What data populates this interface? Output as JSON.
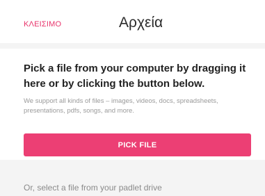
{
  "header": {
    "close_label": "ΚΛΕΙΣΙΜΟ",
    "title": "Αρχεία"
  },
  "upload": {
    "heading": "Pick a file from your computer by dragging it here or by clicking the button below.",
    "description": "We support all kinds of files – images, videos, docs, spreadsheets, presentations, pdfs, songs, and more.",
    "button_label": "PICK FILE"
  },
  "drive": {
    "text": "Or, select a file from your padlet drive"
  },
  "colors": {
    "accent": "#ec3f74",
    "background": "#f4f4f4"
  }
}
